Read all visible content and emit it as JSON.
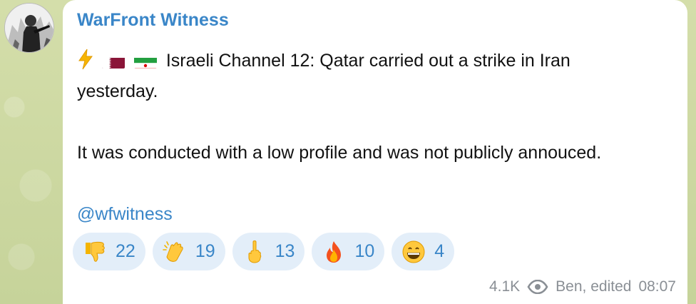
{
  "channel": {
    "name": "WarFront Witness"
  },
  "message": {
    "line1": "Israeli Channel 12: Qatar carried out a strike in Iran",
    "line2": "yesterday.",
    "line3": "It was conducted with a low profile and was not publicly annouced.",
    "mention": "@wfwitness"
  },
  "reactions": [
    {
      "icon": "thumbs-down-icon",
      "count": "22"
    },
    {
      "icon": "clapping-hands-icon",
      "count": "19"
    },
    {
      "icon": "middle-finger-icon",
      "count": "13"
    },
    {
      "icon": "fire-icon",
      "count": "10"
    },
    {
      "icon": "grinning-face-icon",
      "count": "4"
    }
  ],
  "footer": {
    "views": "4.1K",
    "author_edited": "Ben, edited",
    "time": "08:07"
  },
  "colors": {
    "accent": "#3a86c8",
    "reaction_bg": "#e3eef9",
    "background": "#cfd9a5"
  }
}
